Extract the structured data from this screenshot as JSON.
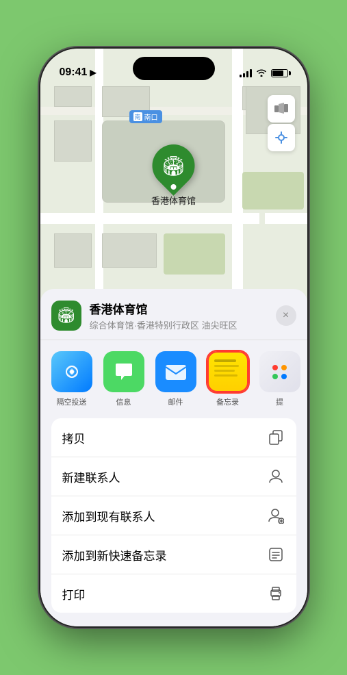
{
  "status": {
    "time": "09:41",
    "location_arrow": "▶"
  },
  "map": {
    "south_entrance_label": "南口",
    "south_entrance_prefix": "南",
    "pin_label": "香港体育馆"
  },
  "sheet": {
    "venue_name": "香港体育馆",
    "venue_sub": "综合体育馆·香港特别行政区 油尖旺区",
    "close_label": "×"
  },
  "share_apps": [
    {
      "id": "airdrop",
      "label": "隔空投送",
      "icon": "📡"
    },
    {
      "id": "messages",
      "label": "信息",
      "icon": "💬"
    },
    {
      "id": "mail",
      "label": "邮件",
      "icon": "✉"
    },
    {
      "id": "notes",
      "label": "备忘录",
      "icon": ""
    }
  ],
  "actions": [
    {
      "id": "copy",
      "label": "拷贝",
      "icon": "⧉"
    },
    {
      "id": "new-contact",
      "label": "新建联系人",
      "icon": "👤"
    },
    {
      "id": "add-contact",
      "label": "添加到现有联系人",
      "icon": "👤"
    },
    {
      "id": "quick-note",
      "label": "添加到新快速备忘录",
      "icon": "⊡"
    },
    {
      "id": "print",
      "label": "打印",
      "icon": "🖨"
    }
  ]
}
